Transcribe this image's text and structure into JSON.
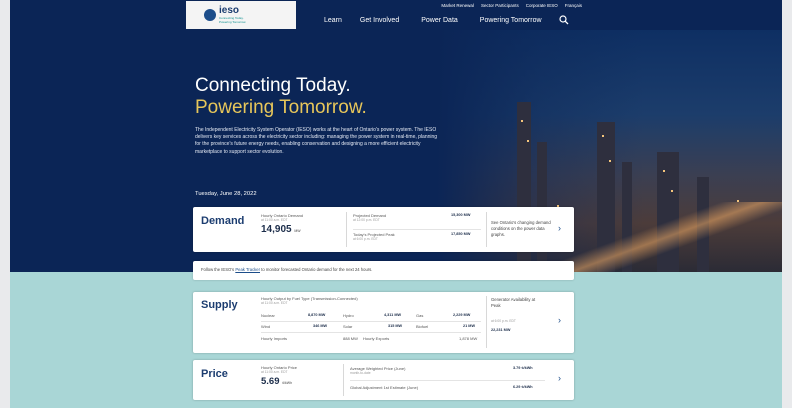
{
  "logo": {
    "word": "ieso",
    "tagline": "Connecting Today. Powering Tomorrow."
  },
  "utility_nav": [
    "Market Renewal",
    "Sector Participants",
    "Corporate IESO",
    "Français"
  ],
  "main_nav": [
    "Learn",
    "Get Involved",
    "Power Data",
    "Powering Tomorrow"
  ],
  "hero": {
    "title_line1": "Connecting Today.",
    "title_line2": "Powering Tomorrow.",
    "intro": "The Independent Electricity System Operator (IESO) works at the heart of Ontario's power system. The IESO delivers key services across the electricity sector including: managing the power system in real-time, planning for the province's future energy needs, enabling conservation and designing a more efficient electricity marketplace to support sector evolution.",
    "date": "Tuesday, June 28, 2022"
  },
  "demand": {
    "title": "Demand",
    "hourly_label": "Hourly Ontario Demand",
    "hourly_time": "at 11:00 a.m. EDT",
    "hourly_value": "14,905",
    "hourly_unit": "MW",
    "projected_label": "Projected Demand",
    "projected_time": "at 12:00 p.m. EDT",
    "projected_value": "15,300 MW",
    "peak_label": "Today's Projected Peak",
    "peak_time": "at 6:00 p.m. EDT",
    "peak_value": "17,850 MW",
    "see_text": "See Ontario's changing demand conditions on the power data graphs."
  },
  "notice": {
    "before": "Follow the IESO's",
    "link": "Peak Tracker",
    "after": "to monitor forecasted Ontario demand for the next 24 hours."
  },
  "supply": {
    "title": "Supply",
    "heading": "Hourly Output by Fuel Type (Transmission-Connected)",
    "time": "at 11:00 a.m. EDT",
    "rows": [
      [
        {
          "name": "Nuclear",
          "value": "8,870 MW"
        },
        {
          "name": "Hydro",
          "value": "4,311 MW"
        },
        {
          "name": "Gas",
          "value": "2,229 MW"
        }
      ],
      [
        {
          "name": "Wind",
          "value": "346 MW"
        },
        {
          "name": "Solar",
          "value": "315 MW"
        },
        {
          "name": "Biofuel",
          "value": "21 MW"
        }
      ]
    ],
    "imports_label": "Hourly Imports",
    "imports_value": "888 MW",
    "exports_label": "Hourly Exports",
    "exports_value": "1,878 MW",
    "gen_label": "Generator Availability at Peak",
    "gen_time": "at 6:00 p.m. EDT",
    "gen_value": "22,231 MW"
  },
  "price": {
    "title": "Price",
    "hoep_label": "Hourly Ontario Price",
    "hoep_time": "at 11:00 a.m. EDT",
    "hoep_value": "5.69",
    "hoep_unit": "¢/kWh",
    "avg_label": "Average Weighted Price (June)",
    "avg_sub": "month-to-date",
    "avg_value": "3.79 ¢/kWh",
    "ga_label": "Global Adjustment 1st Estimate (June)",
    "ga_value": "6.29 ¢/kWh"
  }
}
